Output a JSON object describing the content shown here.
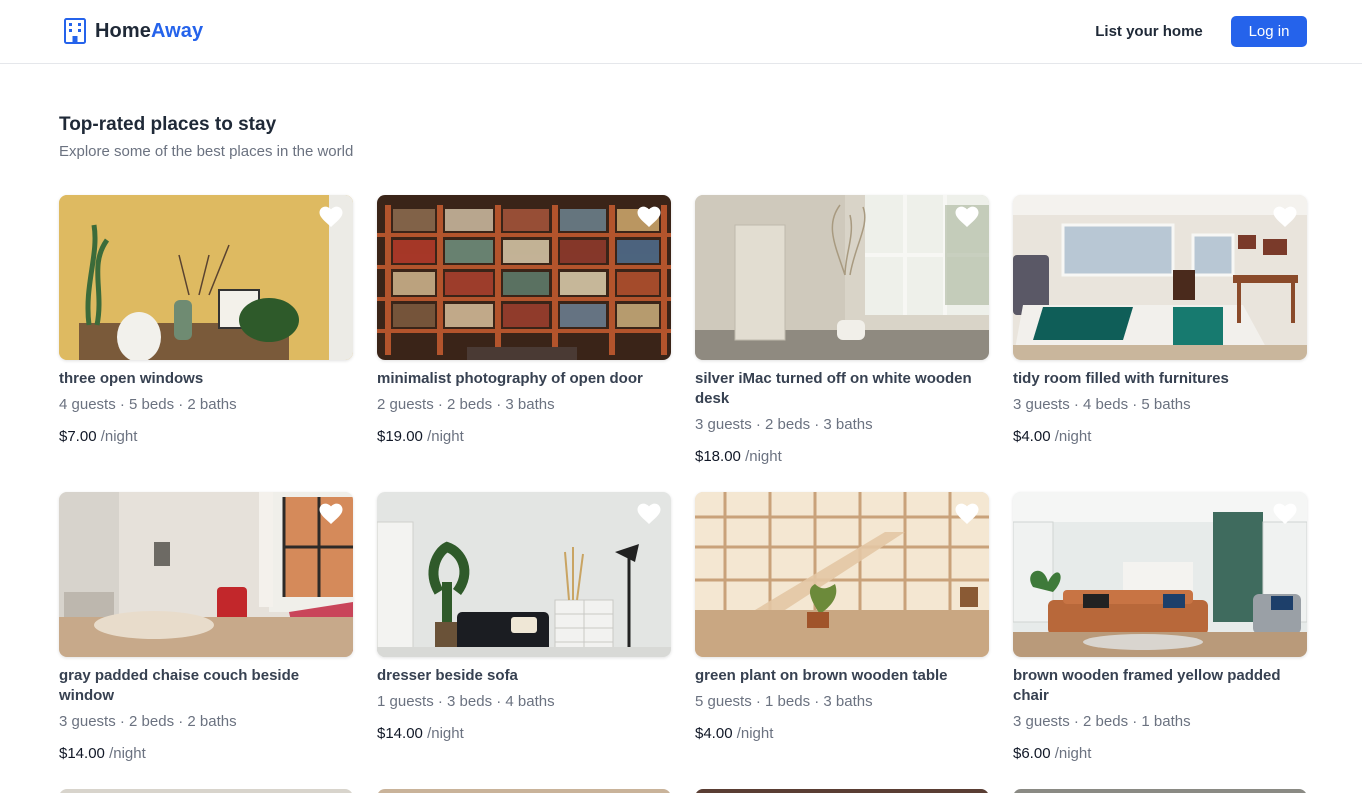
{
  "header": {
    "brand_part1": "Home",
    "brand_part2": "Away",
    "brand_icon": "building-icon",
    "list_home_label": "List your home",
    "login_label": "Log in",
    "accent_color": "#2563eb"
  },
  "section": {
    "title": "Top-rated places to stay",
    "subtitle": "Explore some of the best places in the world"
  },
  "listings": [
    {
      "title": "three open windows",
      "meta": "4 guests · 5 beds · 2 baths",
      "price": "$7.00",
      "unit": "/night"
    },
    {
      "title": "minimalist photography of open door",
      "meta": "2 guests · 2 beds · 3 baths",
      "price": "$19.00",
      "unit": "/night"
    },
    {
      "title": "silver iMac turned off on white wooden desk",
      "meta": "3 guests · 2 beds · 3 baths",
      "price": "$18.00",
      "unit": "/night"
    },
    {
      "title": "tidy room filled with furnitures",
      "meta": "3 guests · 4 beds · 5 baths",
      "price": "$4.00",
      "unit": "/night"
    },
    {
      "title": "gray padded chaise couch beside window",
      "meta": "3 guests · 2 beds · 2 baths",
      "price": "$14.00",
      "unit": "/night"
    },
    {
      "title": "dresser beside sofa",
      "meta": "1 guests · 3 beds · 4 baths",
      "price": "$14.00",
      "unit": "/night"
    },
    {
      "title": "green plant on brown wooden table",
      "meta": "5 guests · 1 beds · 3 baths",
      "price": "$4.00",
      "unit": "/night"
    },
    {
      "title": "brown wooden framed yellow padded chair",
      "meta": "3 guests · 2 beds · 1 baths",
      "price": "$6.00",
      "unit": "/night"
    }
  ]
}
